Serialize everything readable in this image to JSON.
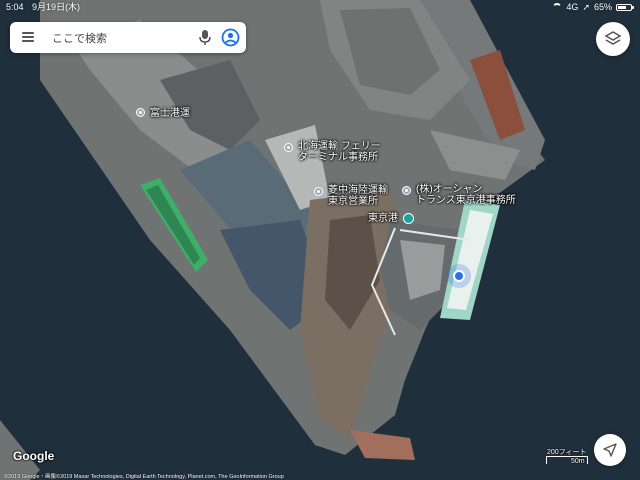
{
  "status_bar": {
    "time": "5:04",
    "date": "9月19日(木)",
    "network": "4G",
    "battery": "65%",
    "battery_level": 0.65
  },
  "search": {
    "placeholder": "ここで検索"
  },
  "places": {
    "fuji": "富士港運",
    "hokkai_line1": "北海運輸 フェリー",
    "hokkai_line2": "ターミナル事務所",
    "ryochu_line1": "菱中海陸運輸",
    "ryochu_line2": "東京営業所",
    "ocean_line1": "(株)オーシャン",
    "ocean_line2": "トランス東京港事務所",
    "port": "東京港"
  },
  "map_footer": {
    "logo": "Google",
    "attribution": "©2019 Google・画像©2019 Maxar Technologies, Digital Earth Technology, Planet.com, The GeoInformation Group",
    "scale_imperial": "200フィート",
    "scale_metric": "50m"
  },
  "icons": {
    "menu": "menu-icon",
    "mic": "mic-icon",
    "account": "account-icon",
    "layers": "layers-icon",
    "compass": "navigation-arrow-icon"
  },
  "colors": {
    "water": "#1f2e3b",
    "pier": "#7d7f7e",
    "location_blue": "#2f6fe6",
    "port_pin": "#1aa39a"
  }
}
